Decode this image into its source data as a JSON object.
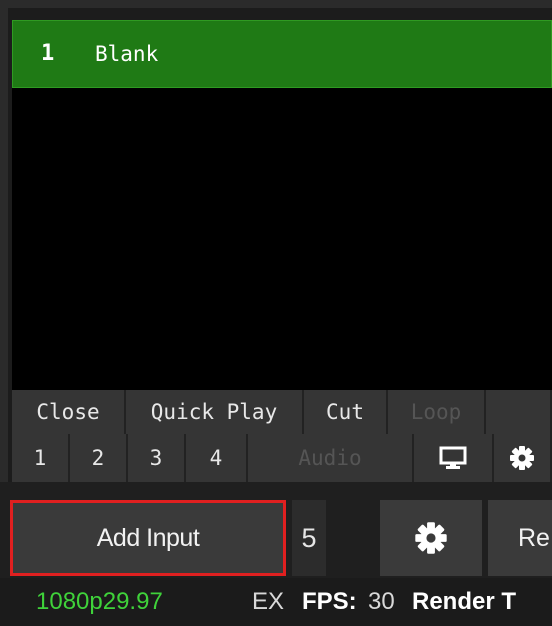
{
  "input": {
    "number": "1",
    "name": "Blank",
    "title_bar_color": "#1f7a15"
  },
  "controls_row1": [
    {
      "label": "Close",
      "enabled": true
    },
    {
      "label": "Quick Play",
      "enabled": true
    },
    {
      "label": "Cut",
      "enabled": true
    },
    {
      "label": "Loop",
      "enabled": false
    },
    {
      "label": "",
      "enabled": false
    }
  ],
  "controls_row2": [
    {
      "label": "1",
      "enabled": true
    },
    {
      "label": "2",
      "enabled": true
    },
    {
      "label": "3",
      "enabled": true
    },
    {
      "label": "4",
      "enabled": true
    },
    {
      "label": "Audio",
      "enabled": false
    },
    {
      "icon": "monitor-icon"
    },
    {
      "icon": "gear-icon"
    }
  ],
  "toolbar": {
    "add_input_label": "Add Input",
    "input_count": "5",
    "settings_icon": "gear-icon",
    "record_label_partial": "Re",
    "highlight_color": "#e02020"
  },
  "status_bar": {
    "format": "1080p29.97",
    "ex": "EX",
    "fps_label": "FPS:",
    "fps_value": "30",
    "render_label_partial": "Render T",
    "format_color": "#3fd23a"
  }
}
